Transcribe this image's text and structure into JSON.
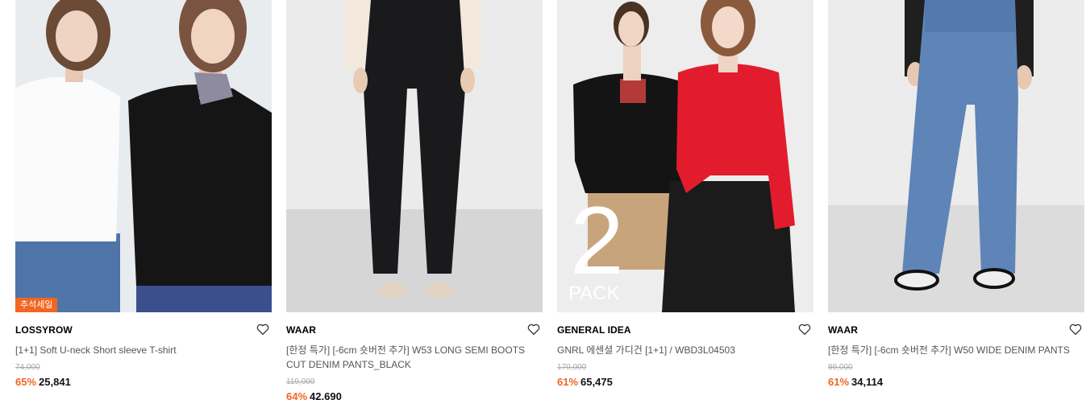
{
  "products": [
    {
      "badge": "추석세일",
      "brand": "LOSSYROW",
      "title": "[1+1] Soft U-neck Short sleeve T-shirt",
      "original_price": "74,000",
      "discount": "65%",
      "price": "25,841"
    },
    {
      "brand": "WAAR",
      "title": "[한정 특가] [-6cm 숏버전 추가] W53 LONG SEMI BOOTS CUT DENIM PANTS_BLACK",
      "original_price": "119,000",
      "discount": "64%",
      "price": "42,690"
    },
    {
      "overlay_text_big": "2",
      "overlay_text_small": "PACK",
      "brand": "GENERAL IDEA",
      "title": "GNRL 에센셜 가디건 [1+1] / WBD3L04503",
      "original_price": "170,000",
      "discount": "61%",
      "price": "65,475"
    },
    {
      "brand": "WAAR",
      "title": "[한정 특가] [-6cm 숏버전 추가] W50 WIDE DENIM PANTS",
      "original_price": "89,000",
      "discount": "61%",
      "price": "34,114"
    }
  ],
  "icons": {
    "wishlist": "heart-outline-icon"
  },
  "colors": {
    "accent": "#f26522",
    "text": "#111111",
    "muted": "#555555",
    "strike": "#a8a8a8"
  }
}
